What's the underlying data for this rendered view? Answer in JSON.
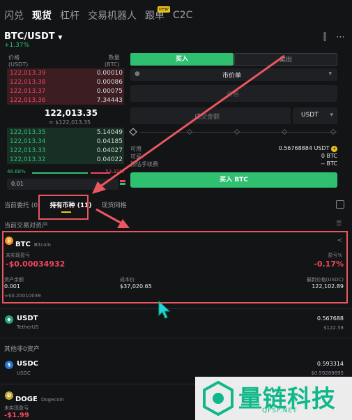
{
  "top_tabs": [
    "闪兑",
    "现货",
    "杠杆",
    "交易机器人",
    "跟单",
    "C2C"
  ],
  "top_badge": "new",
  "pair": {
    "symbol": "BTC/USDT",
    "change": "+1.37%"
  },
  "orderbook": {
    "head_price": "价格",
    "head_price_unit": "(USDT)",
    "head_qty": "数量",
    "head_qty_unit": "(BTC)",
    "asks": [
      {
        "price": "122,013.39",
        "qty": "0.00010"
      },
      {
        "price": "122,013.38",
        "qty": "0.00086"
      },
      {
        "price": "122,013.37",
        "qty": "0.00075"
      },
      {
        "price": "122,013.36",
        "qty": "7.34443"
      }
    ],
    "mid_price": "122,013.35",
    "mid_sub": "≈ $122,013.35",
    "bids": [
      {
        "price": "122,013.35",
        "qty": "5.14049"
      },
      {
        "price": "122,013.34",
        "qty": "0.04185"
      },
      {
        "price": "122,013.33",
        "qty": "0.04027"
      },
      {
        "price": "122,013.32",
        "qty": "0.04022"
      }
    ],
    "buy_ratio": "46.68%",
    "sell_ratio": "53.32%",
    "precision": "0.01"
  },
  "trade_form": {
    "buy_tab": "买入",
    "sell_tab": "卖出",
    "order_type": "市价单",
    "price_placeholder": "价格",
    "amount_placeholder": "成交金额",
    "amount_unit": "USDT",
    "available_label": "可用",
    "available_value": "0.56768884 USDT",
    "can_buy_label": "可买",
    "can_buy_value": "0 BTC",
    "fee_label": "预估手续费",
    "fee_value": "-- BTC",
    "buy_button": "买入 BTC"
  },
  "section_tabs": [
    "当前委托 (0)",
    "持有币种 (11)",
    "现货网格"
  ],
  "current_assets_label": "当前交易对资产",
  "btc_card": {
    "symbol": "BTC",
    "name": "Bitcoin",
    "pnl_label": "未实现盈亏",
    "pnl_value": "-$0.00034932",
    "pnl_pct_label": "盈亏%",
    "pnl_pct_value": "-0.17%",
    "balance_label": "资产余额",
    "balance_value": "0.001",
    "balance_sub": "≈$0.20010039",
    "cost_label": "成本价",
    "cost_value": "$37,020.65",
    "last_label": "最新价格(USDC)",
    "last_value": "122,102.89"
  },
  "usdt_row": {
    "symbol": "USDT",
    "name": "TetherUS",
    "amount": "0.567688",
    "value": "$122.58"
  },
  "other_label": "其他非0资产",
  "usdc_row": {
    "symbol": "USDC",
    "name": "USDC",
    "amount": "0.593314",
    "value": "$0.59289895"
  },
  "doge_row": {
    "symbol": "DOGE",
    "name": "Dogecoin",
    "pnl_label": "未实现盈亏",
    "pnl_value": "-$1.99"
  },
  "watermark": {
    "text": "量链科技",
    "sub": "QFSP.NET"
  },
  "colors": {
    "green": "#2fbf71",
    "red": "#f0455a",
    "accent": "#f0c419",
    "annotation": "#e9575f"
  }
}
